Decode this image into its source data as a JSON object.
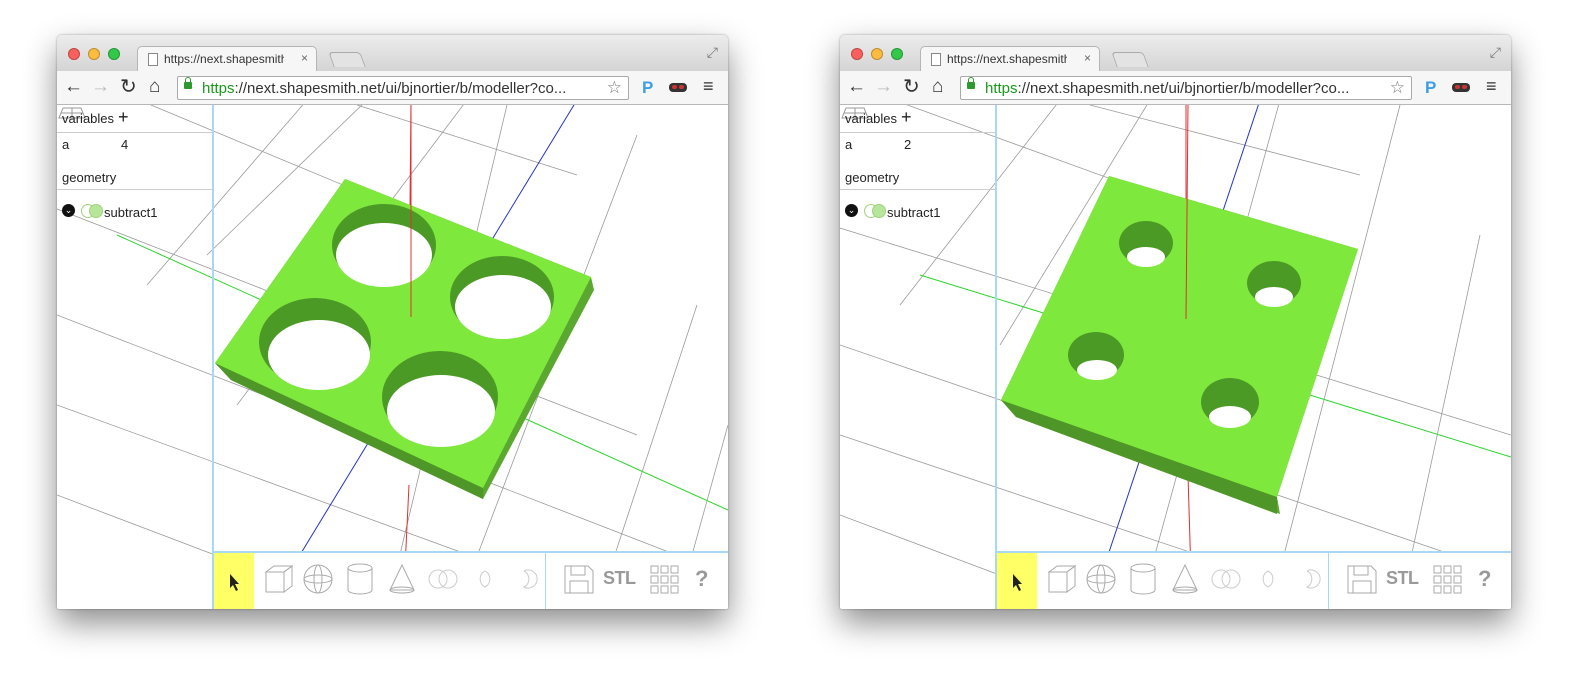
{
  "windows": [
    {
      "tab": {
        "title": "https://next.shapesmith.n",
        "close": "×"
      },
      "url": {
        "scheme": "https",
        "rest": "://next.shapesmith.net/ui/bjnortier/b/modeller?co..."
      },
      "toolbar": {
        "back": "←",
        "forward": "→",
        "reload": "↻",
        "home": "⌂",
        "star": "☆",
        "ext_p": "P",
        "menu": "≡",
        "fullscreen": "⤢"
      },
      "sidebar": {
        "variables_heading": "variables",
        "add": "+",
        "variable": {
          "name": "a",
          "value": "4"
        },
        "geometry_heading": "geometry",
        "expand": "⌄",
        "node_label": "subtract1"
      },
      "bottombar": {
        "stl": "STL",
        "help": "?"
      },
      "model": {
        "hole_scale_variable": 4,
        "color": "#7ee03a"
      }
    },
    {
      "tab": {
        "title": "https://next.shapesmith.n",
        "close": "×"
      },
      "url": {
        "scheme": "https",
        "rest": "://next.shapesmith.net/ui/bjnortier/b/modeller?co..."
      },
      "toolbar": {
        "back": "←",
        "forward": "→",
        "reload": "↻",
        "home": "⌂",
        "star": "☆",
        "ext_p": "P",
        "menu": "≡",
        "fullscreen": "⤢"
      },
      "sidebar": {
        "variables_heading": "variables",
        "add": "+",
        "variable": {
          "name": "a",
          "value": "2"
        },
        "geometry_heading": "geometry",
        "expand": "⌄",
        "node_label": "subtract1"
      },
      "bottombar": {
        "stl": "STL",
        "help": "?"
      },
      "model": {
        "hole_scale_variable": 2,
        "color": "#7ee03a"
      }
    }
  ],
  "colors": {
    "accent_border": "#a7d9f3",
    "select_tool_bg": "#ffff66",
    "model_top": "#7fe83c",
    "model_side_dark": "#5aa830",
    "axis_x": "#2bd42b",
    "axis_y": "#2233cc",
    "axis_z": "#e03030"
  }
}
